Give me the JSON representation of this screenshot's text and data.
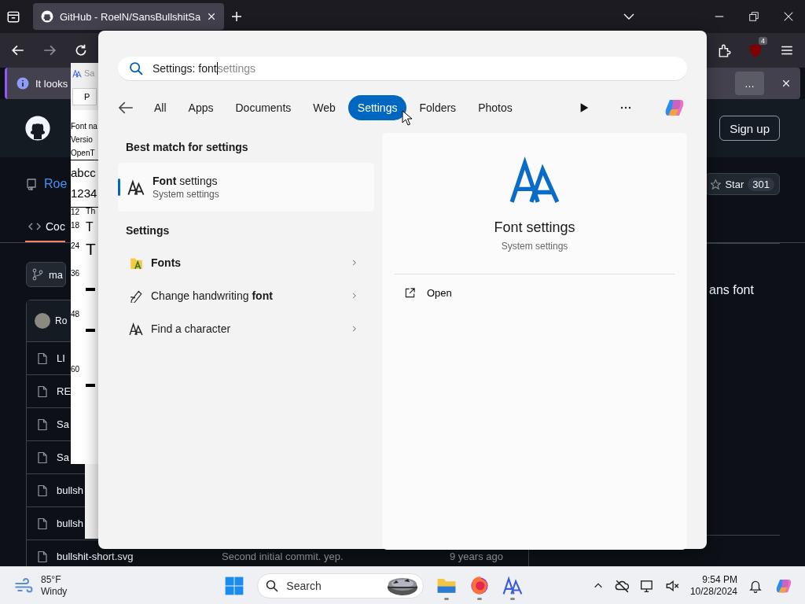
{
  "browser": {
    "tab": {
      "title": "GitHub - RoelN/SansBullshitSa",
      "selected": true
    },
    "extensions_badge": "4",
    "infobar": {
      "text": "It looks",
      "button": "…"
    },
    "github": {
      "sign_up": "Sign up",
      "repo_name": "Roe",
      "star_label": "Star",
      "star_count": "301",
      "code_tab": "Coc",
      "branch": "ma",
      "commit_author": "Ro",
      "about": "ans font",
      "files": [
        {
          "name": "LI"
        },
        {
          "name": "RE"
        },
        {
          "name": "Sa"
        },
        {
          "name": "Sa"
        },
        {
          "name": "bullsh"
        },
        {
          "name": "bullsh"
        },
        {
          "name": "bullshit-short.svg",
          "message": "Second initial commit. yep.",
          "age": "9 years ago"
        }
      ]
    }
  },
  "font_viewer": {
    "title": "Sa",
    "button": "P",
    "info_lines": [
      "Font na",
      "Versio",
      "OpenT"
    ],
    "sample_lines": [
      "abcc",
      "1234"
    ],
    "sizes": [
      {
        "size": "12",
        "sample": "Th"
      },
      {
        "size": "18",
        "sample": "T"
      },
      {
        "size": "24",
        "sample": "T"
      },
      {
        "size": "36"
      },
      {
        "size": "48"
      },
      {
        "size": "60"
      }
    ]
  },
  "search": {
    "query": "Settings: font",
    "suggestion": "settings",
    "filters": [
      {
        "label": "All",
        "selected": false
      },
      {
        "label": "Apps",
        "selected": false
      },
      {
        "label": "Documents",
        "selected": false
      },
      {
        "label": "Web",
        "selected": false
      },
      {
        "label": "Settings",
        "selected": true
      },
      {
        "label": "Folders",
        "selected": false
      },
      {
        "label": "Photos",
        "selected": false
      }
    ],
    "best_match_heading": "Best match for settings",
    "best_match": {
      "title": "**Font** settings",
      "subtitle": "System settings",
      "selected": true
    },
    "settings_heading": "Settings",
    "results": [
      {
        "kind": "fonts",
        "title": "**Fonts**"
      },
      {
        "kind": "handwriting",
        "title": "Change handwriting **font**"
      },
      {
        "kind": "character",
        "title": "Find a character"
      }
    ],
    "detail": {
      "title": "Font settings",
      "subtitle": "System settings",
      "action": "Open"
    }
  },
  "taskbar": {
    "temperature": "85°F",
    "condition": "Windy",
    "search": "Search",
    "time": "9:54 PM",
    "date": "10/28/2024"
  }
}
